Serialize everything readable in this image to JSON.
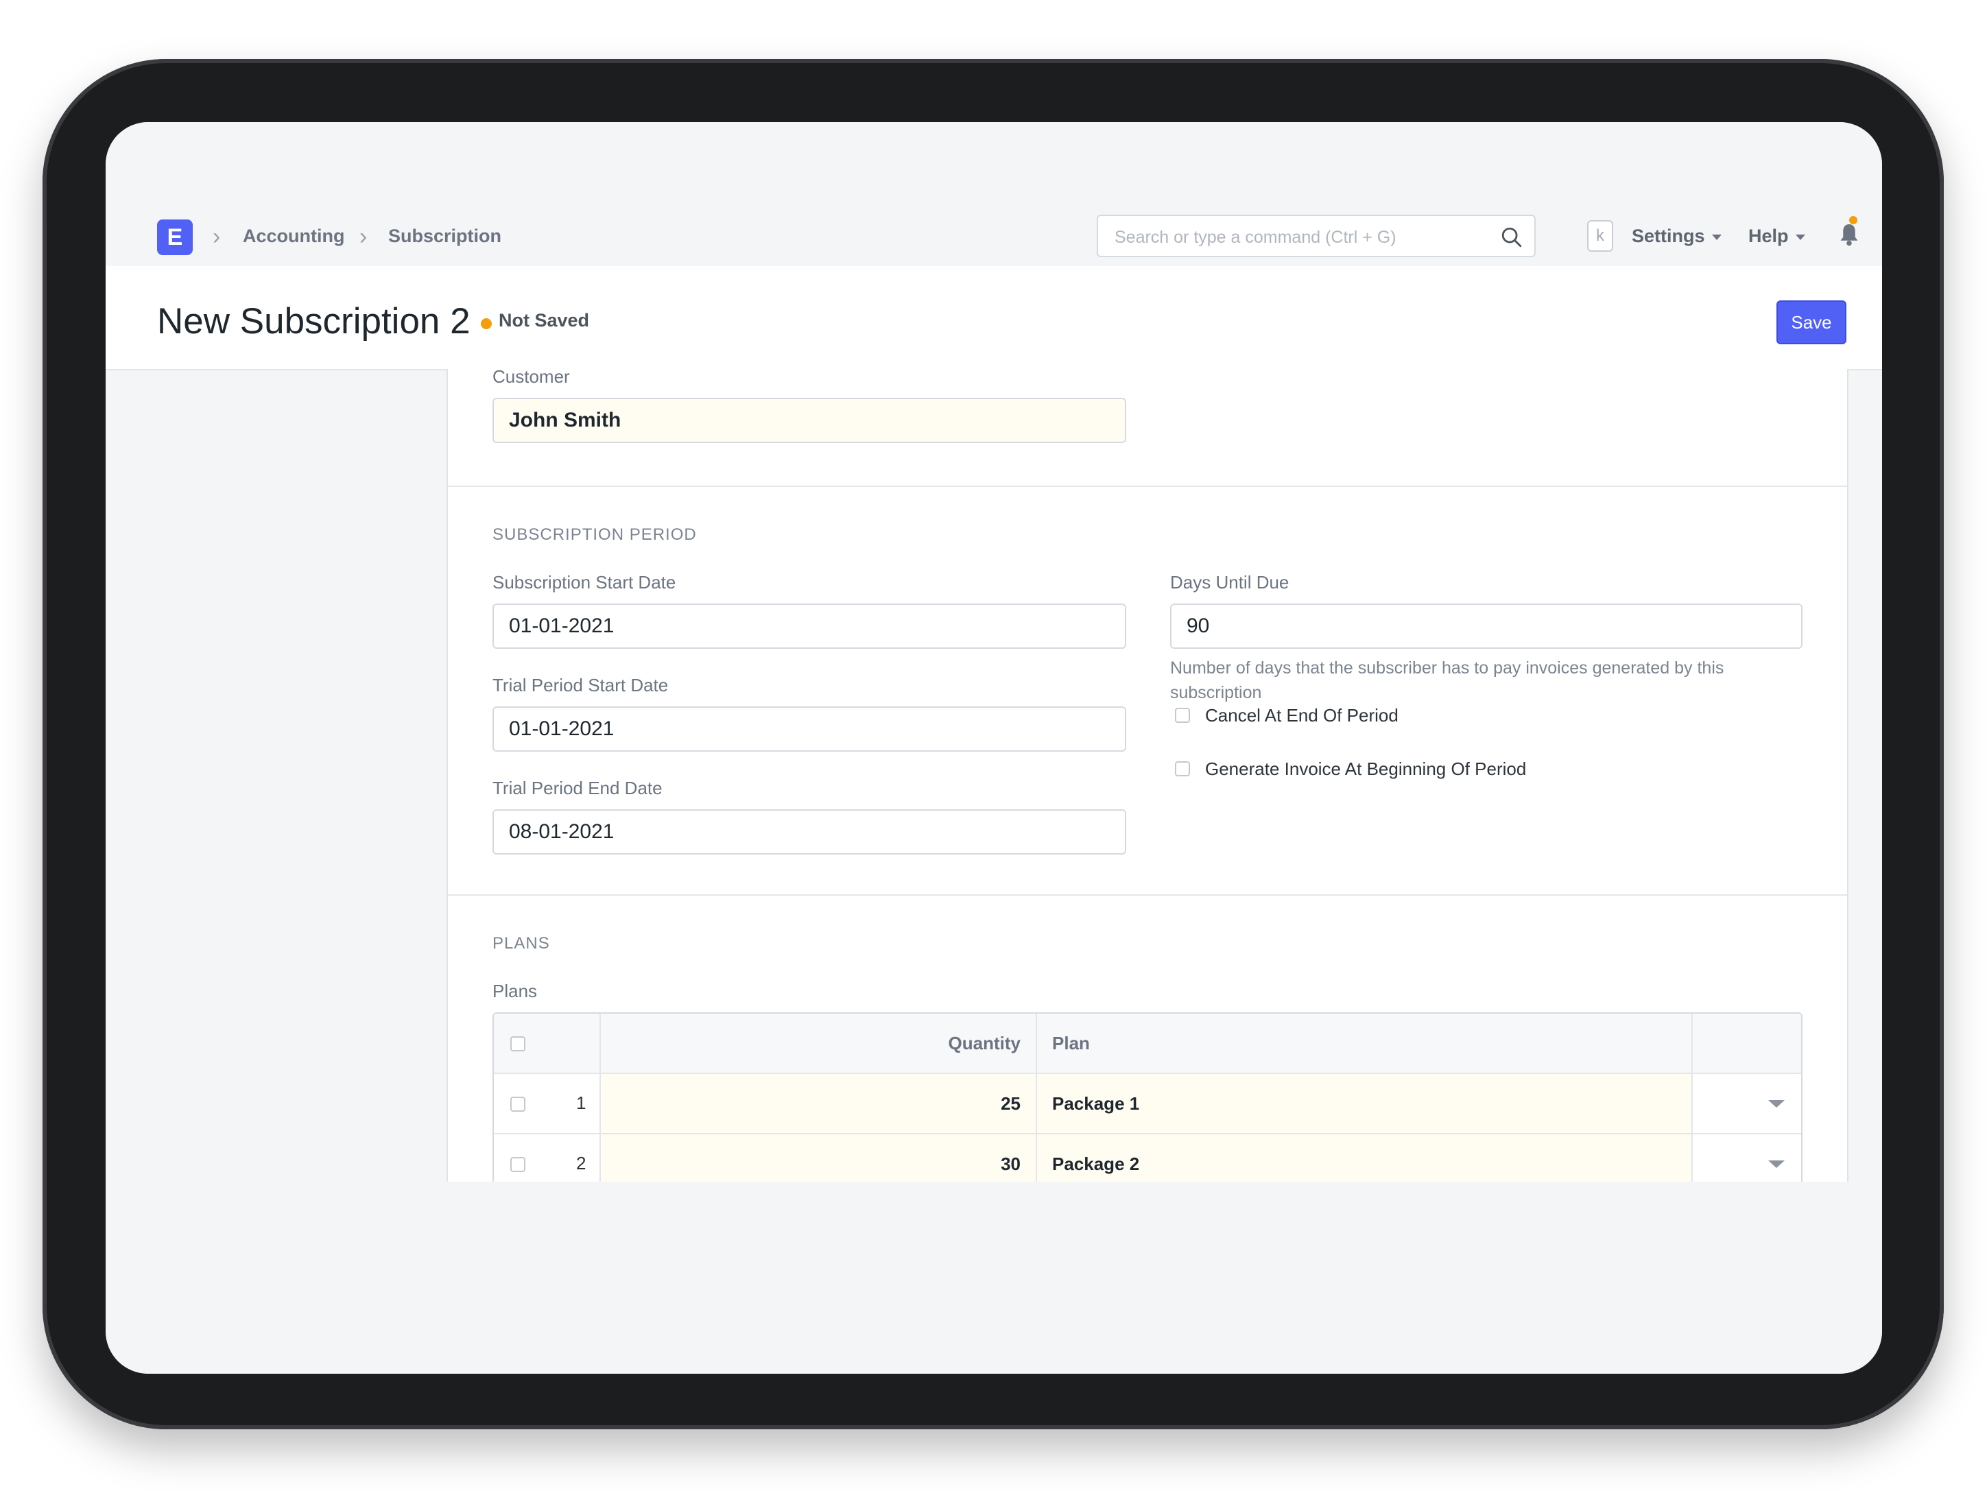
{
  "navbar": {
    "logo_letter": "E",
    "breadcrumbs": [
      "Accounting",
      "Subscription"
    ],
    "search_placeholder": "Search or type a command (Ctrl + G)",
    "kbd_hint": "k",
    "settings_label": "Settings",
    "help_label": "Help"
  },
  "page": {
    "title": "New Subscription 2",
    "status": "Not Saved",
    "save_label": "Save"
  },
  "customer": {
    "label": "Customer",
    "value": "John Smith"
  },
  "subscription_period": {
    "section_title": "SUBSCRIPTION PERIOD",
    "start_date_label": "Subscription Start Date",
    "start_date": "01-01-2021",
    "trial_start_label": "Trial Period Start Date",
    "trial_start": "01-01-2021",
    "trial_end_label": "Trial Period End Date",
    "trial_end": "08-01-2021",
    "days_until_due_label": "Days Until Due",
    "days_until_due": "90",
    "days_until_due_desc": "Number of days that the subscriber has to pay invoices generated by this subscription",
    "cancel_at_end_label": "Cancel At End Of Period",
    "generate_invoice_label": "Generate Invoice At Beginning Of Period"
  },
  "plans": {
    "section_title": "PLANS",
    "table_label": "Plans",
    "columns": {
      "quantity": "Quantity",
      "plan": "Plan"
    },
    "rows": [
      {
        "num": "1",
        "quantity": "25",
        "plan": "Package 1"
      },
      {
        "num": "2",
        "quantity": "30",
        "plan": "Package 2"
      }
    ]
  },
  "colors": {
    "accent": "#5160f5",
    "status_dot": "#f59e0b",
    "field_highlight": "#fffdf2"
  }
}
